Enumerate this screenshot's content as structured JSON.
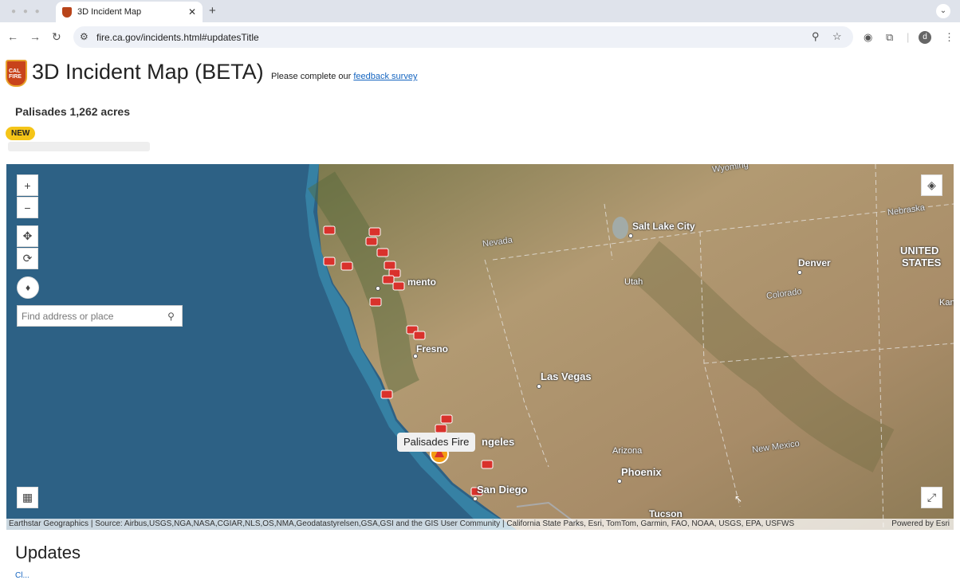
{
  "browser": {
    "tab_title": "3D Incident Map",
    "url": "fire.ca.gov/incidents.html#updatesTitle",
    "profile_initial": "d"
  },
  "header": {
    "logo_text": "CAL FIRE",
    "title": "3D Incident Map (BETA)",
    "survey_text": "Please complete our",
    "survey_link": "feedback survey"
  },
  "incident": {
    "title": "Palisades 1,262 acres",
    "badge": "NEW"
  },
  "map": {
    "zoom_in": "+",
    "zoom_out": "−",
    "search_placeholder": "Find address or place",
    "popup": "Palisades Fire",
    "labels": {
      "wyoming": "Wyoming",
      "nebraska": "Nebraska",
      "salt_lake": "Salt Lake City",
      "nevada": "Nevada",
      "united_states_1": "UNITED",
      "united_states_2": "STATES",
      "denver": "Denver",
      "sacramento": "mento",
      "utah": "Utah",
      "colorado": "Colorado",
      "kansas": "Kans",
      "fresno": "Fresno",
      "las_vegas": "Las Vegas",
      "angeles": "ngeles",
      "arizona": "Arizona",
      "new_mexico": "New Mexico",
      "phoenix": "Phoenix",
      "san_diego": "San Diego",
      "tucson": "Tucson"
    },
    "attribution": "Earthstar Geographics | Source: Airbus,USGS,NGA,NASA,CGIAR,NLS,OS,NMA,Geodatastyrelsen,GSA,GSI and the GIS User Community | California State Parks, Esri, TomTom, Garmin, FAO, NOAA, USGS, EPA, USFWS",
    "powered_by": "Powered by Esri"
  },
  "section": {
    "updates_title": "Updates",
    "updates_sub": "Cl..."
  },
  "colors": {
    "accent_link": "#1565c0",
    "badge": "#f5c518",
    "fire_marker": "#d9322c"
  }
}
